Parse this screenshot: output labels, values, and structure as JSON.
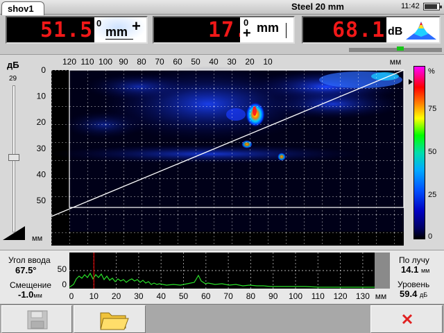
{
  "tab": {
    "label": "shov1"
  },
  "window_title": "Steel 20 mm",
  "status": {
    "clock": "11:42",
    "battery_level": 0.8
  },
  "readouts": [
    {
      "value": "51.5",
      "icon": "x-distance-icon",
      "icon_zero": "0",
      "icon_unit": "mm",
      "icon_sign": "+"
    },
    {
      "value": "17.2",
      "icon": "depth-icon",
      "icon_zero": "0",
      "icon_unit": "mm",
      "icon_sign": "+"
    },
    {
      "value": "68.1",
      "icon": "amplitude-icon",
      "icon_unit": "dB"
    }
  ],
  "colors": {
    "led": "#f01818",
    "trace": "#29e029",
    "gate_line": "#ff0000",
    "gain_marker": "#19c419"
  },
  "gain_marker_fraction": 0.55,
  "gain_panel": {
    "label": "дБ",
    "value": "29",
    "slider_fraction": 0.49
  },
  "scan": {
    "x_ticks": [
      "120",
      "110",
      "100",
      "90",
      "80",
      "70",
      "60",
      "50",
      "40",
      "30",
      "20",
      "10"
    ],
    "x_unit": "мм",
    "y_ticks": [
      "0",
      "10",
      "20",
      "30",
      "40",
      "50"
    ],
    "y_unit": "мм",
    "scale_ticks": [
      "%",
      "75",
      "50",
      "25",
      "0"
    ]
  },
  "ascan": {
    "x_ticks": [
      "0",
      "10",
      "20",
      "30",
      "40",
      "50",
      "60",
      "70",
      "80",
      "90",
      "100",
      "110",
      "120",
      "130"
    ],
    "x_unit": "мм",
    "y_ticks": [
      "50",
      "0"
    ],
    "gate_position_mm": 10
  },
  "left_info": {
    "angle_label": "Угол ввода",
    "angle_value": "67.5°",
    "offset_label": "Смещение",
    "offset_value": "-1.0",
    "offset_unit": "мм"
  },
  "right_info": {
    "beam_label": "По лучу",
    "beam_value": "14.1",
    "beam_unit": "мм",
    "level_label": "Уровень",
    "level_value": "59.4",
    "level_unit": "дБ"
  },
  "toolbar": {
    "buttons": [
      "save-icon",
      "folder-icon",
      "close-icon"
    ]
  }
}
